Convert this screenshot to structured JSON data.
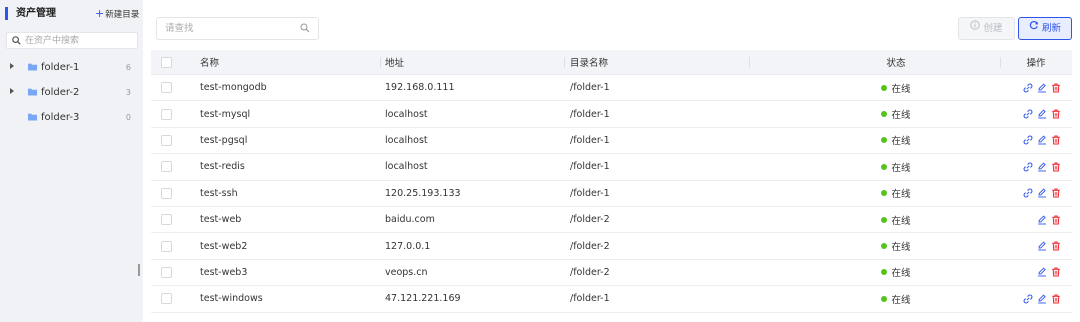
{
  "sidebar": {
    "title": "资产管理",
    "new_dir": "新建目录",
    "search_placeholder": "在资产中搜索",
    "folders": [
      {
        "name": "folder-1",
        "count": "6",
        "expandable": true
      },
      {
        "name": "folder-2",
        "count": "3",
        "expandable": true
      },
      {
        "name": "folder-3",
        "count": "0",
        "expandable": false
      }
    ]
  },
  "toolbar": {
    "search_placeholder": "请查找",
    "create_label": "创建",
    "refresh_label": "刷新"
  },
  "table": {
    "columns": [
      "名称",
      "地址",
      "目录名称",
      "状态",
      "操作"
    ],
    "rows": [
      {
        "name": "test-mongodb",
        "address": "192.168.0.111",
        "dir": "/folder-1",
        "status": "在线",
        "ops": [
          "connect",
          "edit",
          "delete"
        ]
      },
      {
        "name": "test-mysql",
        "address": "localhost",
        "dir": "/folder-1",
        "status": "在线",
        "ops": [
          "connect",
          "edit",
          "delete"
        ]
      },
      {
        "name": "test-pgsql",
        "address": "localhost",
        "dir": "/folder-1",
        "status": "在线",
        "ops": [
          "connect",
          "edit",
          "delete"
        ]
      },
      {
        "name": "test-redis",
        "address": "localhost",
        "dir": "/folder-1",
        "status": "在线",
        "ops": [
          "connect",
          "edit",
          "delete"
        ]
      },
      {
        "name": "test-ssh",
        "address": "120.25.193.133",
        "dir": "/folder-1",
        "status": "在线",
        "ops": [
          "connect",
          "edit",
          "delete"
        ]
      },
      {
        "name": "test-web",
        "address": "baidu.com",
        "dir": "/folder-2",
        "status": "在线",
        "ops": [
          "edit",
          "delete"
        ]
      },
      {
        "name": "test-web2",
        "address": "127.0.0.1",
        "dir": "/folder-2",
        "status": "在线",
        "ops": [
          "edit",
          "delete"
        ]
      },
      {
        "name": "test-web3",
        "address": "veops.cn",
        "dir": "/folder-2",
        "status": "在线",
        "ops": [
          "edit",
          "delete"
        ]
      },
      {
        "name": "test-windows",
        "address": "47.121.221.169",
        "dir": "/folder-1",
        "status": "在线",
        "ops": [
          "connect",
          "edit",
          "delete"
        ]
      }
    ]
  },
  "colors": {
    "accent": "#2f54eb",
    "online": "#52c41a",
    "delete": "#f5222d",
    "folder": "#7aa7f5"
  }
}
